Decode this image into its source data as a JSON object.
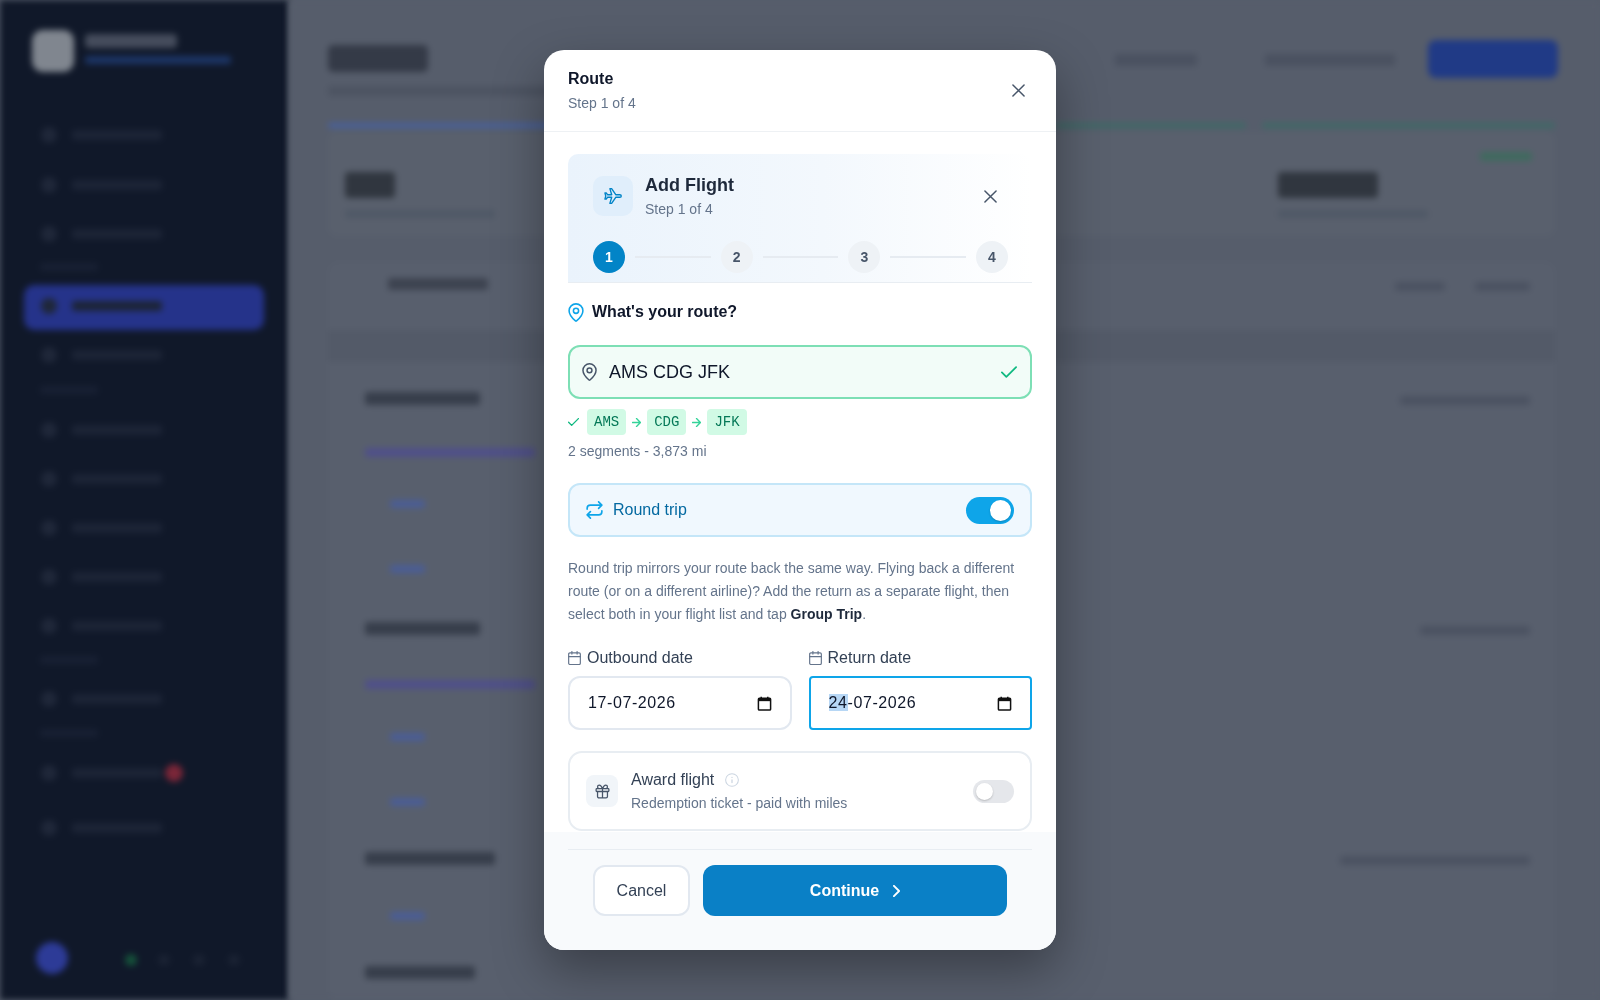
{
  "dialog": {
    "title": "Route",
    "subtitle": "Step 1 of 4"
  },
  "wizard": {
    "title": "Add Flight",
    "subtitle": "Step 1 of 4",
    "steps": [
      {
        "label": "1",
        "selected": true
      },
      {
        "label": "2",
        "selected": false
      },
      {
        "label": "3",
        "selected": false
      },
      {
        "label": "4",
        "selected": false
      }
    ]
  },
  "route_section": {
    "heading": "What's your route?",
    "route_input": {
      "value": "AMS CDG JFK",
      "valid": true
    },
    "airports": [
      "AMS",
      "CDG",
      "JFK"
    ],
    "summary": "2 segments - 3,873 mi"
  },
  "round_trip": {
    "label": "Round trip",
    "on": true
  },
  "note": "Round trip mirrors your route back the same way. Flying back a different route (or on a different airline)? Add the return as a separate flight, then select both in your flight list and tap **Group Trip**.",
  "dates": [
    {
      "label": "Outbound date",
      "value": "17-07-2026",
      "focused": false
    },
    {
      "label": "Return date",
      "value": "24-07-2026",
      "focused": true
    }
  ],
  "award_flight": {
    "title": "Award flight",
    "subtitle": "Redemption ticket - paid with miles",
    "on": false
  },
  "buttons": [
    {
      "label": "Cancel",
      "kind": "secondary"
    },
    {
      "label": "Continue",
      "kind": "primary"
    }
  ]
}
